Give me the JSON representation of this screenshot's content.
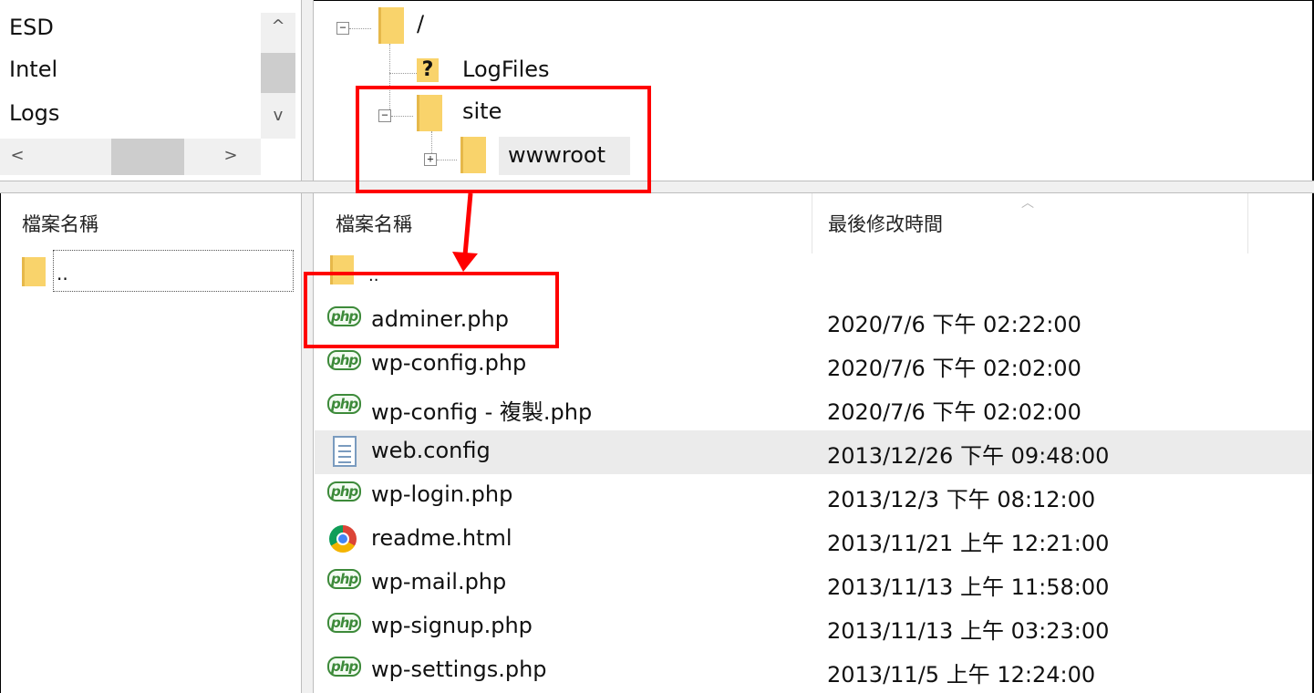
{
  "local_dirs": {
    "items": [
      "ESD",
      "Intel",
      "Logs"
    ],
    "scroll_up": "^",
    "scroll_down": "v",
    "scroll_left": "<",
    "scroll_right": ">"
  },
  "remote_tree": {
    "root": "/",
    "logfiles": "LogFiles",
    "logfiles_badge": "?",
    "site": "site",
    "wwwroot": "wwwroot",
    "collapse_glyph": "−",
    "expand_glyph": "+"
  },
  "local_list": {
    "header_name": "檔案名稱",
    "parent": ".."
  },
  "remote_list": {
    "header_name": "檔案名稱",
    "header_modified": "最後修改時間",
    "parent": "..",
    "files": [
      {
        "name": "adminer.php",
        "modified": "2020/7/6 下午 02:22:00",
        "icon": "php-icon"
      },
      {
        "name": "wp-config.php",
        "modified": "2020/7/6 下午 02:02:00",
        "icon": "php-icon"
      },
      {
        "name": "wp-config - 複製.php",
        "modified": "2020/7/6 下午 02:02:00",
        "icon": "php-icon"
      },
      {
        "name": "web.config",
        "modified": "2013/12/26 下午 09:48:00",
        "icon": "document-icon"
      },
      {
        "name": "wp-login.php",
        "modified": "2013/12/3 下午 08:12:00",
        "icon": "php-icon"
      },
      {
        "name": "readme.html",
        "modified": "2013/11/21 上午 12:21:00",
        "icon": "chrome-icon"
      },
      {
        "name": "wp-mail.php",
        "modified": "2013/11/13 上午 11:58:00",
        "icon": "php-icon"
      },
      {
        "name": "wp-signup.php",
        "modified": "2013/11/13 上午 03:23:00",
        "icon": "php-icon"
      },
      {
        "name": "wp-settings.php",
        "modified": "2013/11/5 上午 12:24:00",
        "icon": "php-icon"
      }
    ]
  },
  "colors": {
    "annotation": "#ff0000",
    "folder": "#f9d36b",
    "php_icon": "#3d8a3a",
    "selected_row": "#ebebeb"
  }
}
